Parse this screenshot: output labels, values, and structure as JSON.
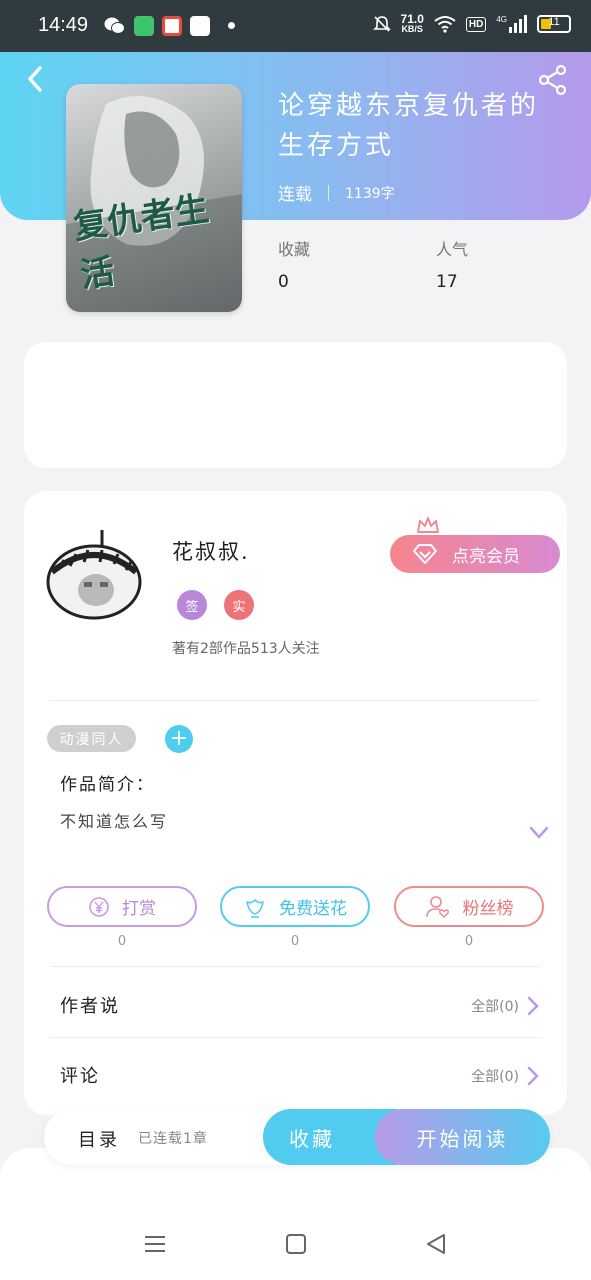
{
  "status_bar": {
    "time": "14:49",
    "net_speed_value": "71.0",
    "net_speed_unit": "KB/S",
    "hd": "HD",
    "signal": "4G",
    "battery": "11"
  },
  "book": {
    "title": "论穿越东京复仇者的生存方式",
    "status": "连载",
    "word_count": "1139字",
    "cover_text": "复仇者生活",
    "stats": [
      {
        "label": "收藏",
        "value": "0"
      },
      {
        "label": "人气",
        "value": "17"
      }
    ]
  },
  "author": {
    "name": "花叔叔.",
    "badges": [
      "签",
      "实"
    ],
    "stats_text": "著有2部作品513人关注",
    "vip_label": "点亮会员"
  },
  "tags": [
    "动漫同人"
  ],
  "intro": {
    "label": "作品简介：",
    "text": "不知道怎么写"
  },
  "actions": [
    {
      "label": "打赏",
      "count": "0",
      "color": "#c79be8"
    },
    {
      "label": "免费送花",
      "count": "0",
      "color": "#55ccee"
    },
    {
      "label": "粉丝榜",
      "count": "0",
      "color": "#ee8b8f"
    }
  ],
  "sections": [
    {
      "label": "作者说",
      "link": "全部(0)"
    },
    {
      "label": "评论",
      "link": "全部(0)"
    }
  ],
  "bottom_bar": {
    "toc_label": "目录",
    "toc_status": "已连载1章",
    "collect_label": "收藏",
    "read_label": "开始阅读"
  }
}
